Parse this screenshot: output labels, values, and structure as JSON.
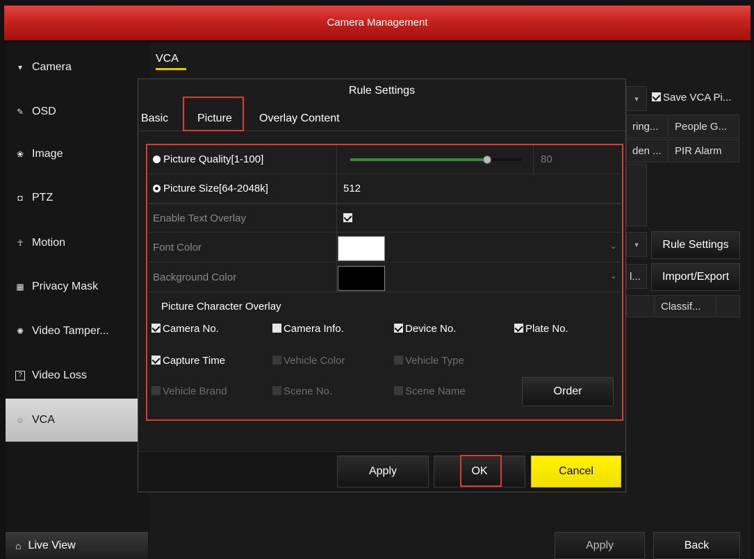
{
  "window": {
    "title": "Camera Management"
  },
  "sidebar": {
    "items": [
      {
        "label": "Camera",
        "icon": "camera-icon",
        "glyph": "▾"
      },
      {
        "label": "OSD",
        "icon": "osd-icon",
        "glyph": "✎"
      },
      {
        "label": "Image",
        "icon": "image-icon",
        "glyph": "❀"
      },
      {
        "label": "PTZ",
        "icon": "ptz-icon",
        "glyph": "◘"
      },
      {
        "label": "Motion",
        "icon": "motion-icon",
        "glyph": "☥"
      },
      {
        "label": "Privacy Mask",
        "icon": "privacy-mask-icon",
        "glyph": "▦"
      },
      {
        "label": "Video Tamper...",
        "icon": "video-tamper-icon",
        "glyph": "✺"
      },
      {
        "label": "Video Loss",
        "icon": "video-loss-icon",
        "glyph": "?"
      },
      {
        "label": "VCA",
        "icon": "vca-icon",
        "glyph": "☺",
        "active": true
      }
    ],
    "live_view": {
      "label": "Live View",
      "icon": "home-icon",
      "glyph": "⌂"
    }
  },
  "main": {
    "tab": "VCA",
    "bg": {
      "save_vca": "Save VCA Pi...",
      "cell_ring": "ring...",
      "cell_people": "People G...",
      "cell_den": "den ...",
      "cell_pir": "PIR Alarm",
      "rule_settings": "Rule Settings",
      "import_export": "Import/Export",
      "ellipsis": "l...",
      "classif": "Classif...",
      "apply": "Apply",
      "back": "Back"
    }
  },
  "dialog": {
    "title": "Rule Settings",
    "tabs": [
      "Basic",
      "Picture",
      "Overlay Content"
    ],
    "active_tab": "Picture",
    "picture_quality": {
      "label": "Picture Quality[1-100]",
      "value": "80",
      "fraction": 0.8
    },
    "picture_size": {
      "label": "Picture Size[64-2048k]",
      "value": "512"
    },
    "enable_text_overlay": {
      "label": "Enable Text Overlay",
      "checked": true
    },
    "font_color": {
      "label": "Font Color",
      "color": "#ffffff"
    },
    "background_color": {
      "label": "Background Color",
      "color": "#000000"
    },
    "overlay_section": "Picture Character Overlay",
    "overlay_items": [
      {
        "label": "Camera No.",
        "checked": true,
        "enabled": true
      },
      {
        "label": "Camera Info.",
        "checked": false,
        "enabled": true
      },
      {
        "label": "Device No.",
        "checked": true,
        "enabled": true
      },
      {
        "label": "Plate No.",
        "checked": true,
        "enabled": true
      },
      {
        "label": "Capture Time",
        "checked": true,
        "enabled": true
      },
      {
        "label": "Vehicle Color",
        "checked": false,
        "enabled": false
      },
      {
        "label": "Vehicle Type",
        "checked": false,
        "enabled": false
      },
      {
        "label": "Vehicle Brand",
        "checked": false,
        "enabled": false
      },
      {
        "label": "Scene No.",
        "checked": false,
        "enabled": false
      },
      {
        "label": "Scene Name",
        "checked": false,
        "enabled": false
      }
    ],
    "order_button": "Order",
    "apply_button": "Apply",
    "ok_button": "OK",
    "cancel_button": "Cancel",
    "accent_color": "#e23b2e",
    "cancel_color": "#fff200"
  }
}
